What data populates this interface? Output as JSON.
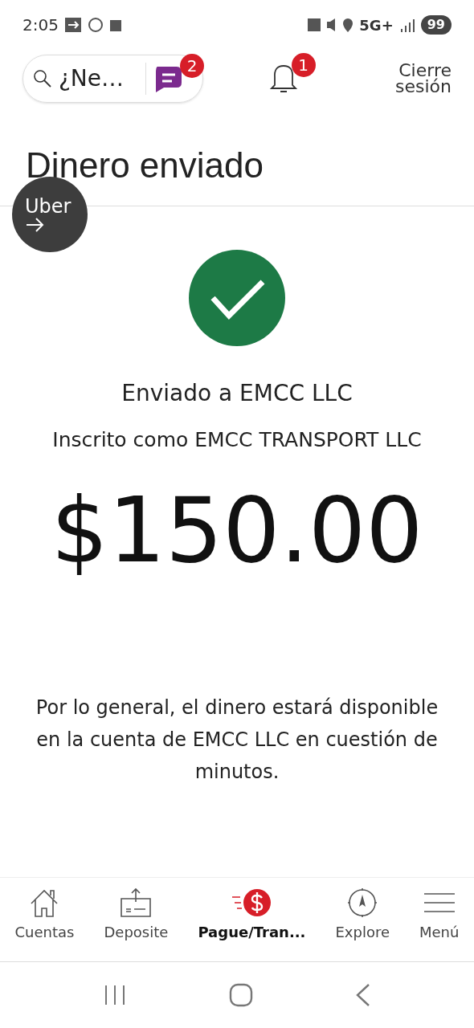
{
  "status_bar": {
    "time": "2:05",
    "network": "5G+",
    "battery": "99"
  },
  "header": {
    "search": {
      "placeholder": "¿Ne…"
    },
    "chat_badge": "2",
    "notification_badge": "1",
    "logout": "Cierre sesión"
  },
  "title": "Dinero enviado",
  "floating_bubble": {
    "label": "Uber"
  },
  "confirmation": {
    "sent_to": "Enviado a EMCC LLC",
    "registered_as": "Inscrito como EMCC TRANSPORT LLC",
    "amount": "$150.00",
    "note": "Por lo general, el dinero estará disponible en la cuenta de EMCC LLC en cuestión de minutos."
  },
  "bottom_nav": [
    {
      "kind": "home",
      "label": "Cuentas",
      "selected": false
    },
    {
      "kind": "deposit",
      "label": "Deposite",
      "selected": false
    },
    {
      "kind": "pay",
      "label": "Pague/Tran...",
      "selected": true
    },
    {
      "kind": "explore",
      "label": "Explore",
      "selected": false
    },
    {
      "kind": "menu",
      "label": "Menú",
      "selected": false
    }
  ]
}
